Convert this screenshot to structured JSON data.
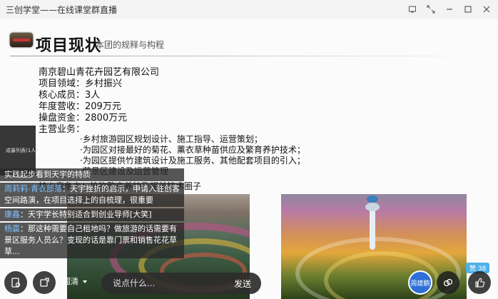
{
  "window": {
    "title": "三创学堂——在线课堂群直播",
    "controls": [
      "pin-icon",
      "shrink-icon",
      "minimize-icon",
      "maximize-icon",
      "close-icon"
    ]
  },
  "slide": {
    "title": "项目现状",
    "subtitle": "本团的规释与构程",
    "company": "南京碧山青花卉园艺有限公司",
    "lines": [
      "项目领域：乡村振兴",
      "核心成员：3人",
      "年度营收：209万元",
      "操盘资金：2800万元",
      "主营业务："
    ],
    "bullets": [
      "·乡村旅游园区规划设计、施工指导、运营策划；",
      "·为园区对接最好的菊花、薰衣草种苗供应及繁育养护技术；",
      "·为园区提供竹建筑设计及施工服务、其他配套项目的引入；",
      "·营景区建设及运营管理"
    ],
    "core": "核心竞争力：植物繁育养护及相关技术圈子"
  },
  "sidepanel": {
    "label": "成暴列表(1人)"
  },
  "chat": [
    {
      "name": "",
      "text": "实践起步看到天宇的特质"
    },
    {
      "name": "周莉莉-青衣部落",
      "text": "：天宇挫折的启示，申请入驻创客空间路演，在项目选择上的自梳理，很重要"
    },
    {
      "name": "康鑫",
      "text": "：天宇学长特别适合到创业导师[大笑]"
    },
    {
      "name": "杨震",
      "text": "：那这种需要自己租地吗？做旅游的话需要有景区服务人员么？变现的话是靠门票和销售花花草草..."
    }
  ],
  "bottombar": {
    "quality": "超清",
    "input_placeholder": "说点什么...",
    "send_label": "发送",
    "host_name": "周建鹏",
    "likes_label": "赞",
    "likes_count": "38"
  }
}
